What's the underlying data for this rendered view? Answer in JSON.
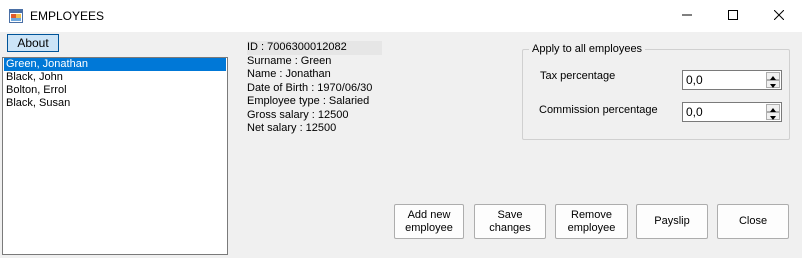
{
  "window": {
    "title": "EMPLOYEES",
    "icon": "app-window-icon",
    "controls": [
      "minimize-icon",
      "maximize-icon",
      "close-icon"
    ]
  },
  "about_button": "About",
  "employees": [
    {
      "name": "Green, Jonathan",
      "selected": true
    },
    {
      "name": "Black, John",
      "selected": false
    },
    {
      "name": "Bolton, Errol",
      "selected": false
    },
    {
      "name": "Black, Susan",
      "selected": false
    }
  ],
  "details": {
    "id": "ID : 7006300012082",
    "surname": "Surname : Green",
    "name": "Name : Jonathan",
    "dob": "Date of Birth : 1970/06/30",
    "type": "Employee type : Salaried",
    "gross": "Gross salary : 12500",
    "net": "Net salary : 12500"
  },
  "apply_group": {
    "title": "Apply to all employees",
    "tax_label": "Tax percentage",
    "tax_value": "0,0",
    "commission_label": "Commission percentage",
    "commission_value": "0,0"
  },
  "buttons": {
    "add_line1": "Add new",
    "add_line2": "employee",
    "save_line1": "Save",
    "save_line2": "changes",
    "remove_line1": "Remove",
    "remove_line2": "employee",
    "payslip": "Payslip",
    "close": "Close"
  },
  "colors": {
    "selection": "#0078d7",
    "about_bg": "#cce4f7",
    "about_border": "#005499",
    "window_bg": "#f0f0f0"
  }
}
